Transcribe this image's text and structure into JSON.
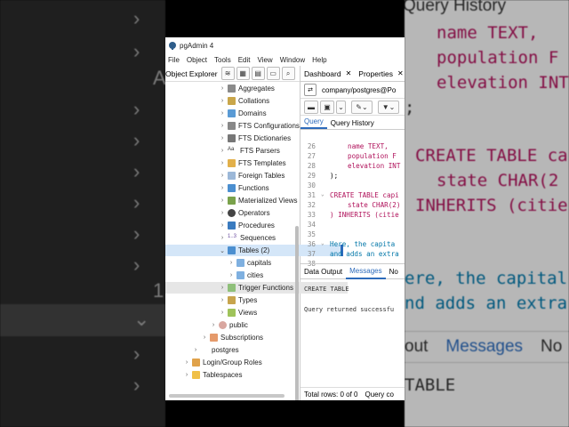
{
  "background_left": {
    "rows": [
      "",
      "",
      "A",
      "",
      "",
      "",
      "",
      "",
      "1.",
      "",
      ""
    ]
  },
  "background_right": {
    "title": "Query History",
    "lines": [
      "name TEXT,",
      "population F",
      "elevation INT",
      ";",
      "",
      "CREATE TABLE capi",
      "state CHAR(2",
      "INHERITS (citie",
      "",
      "ere, the capital",
      "nd adds an extra"
    ],
    "tabs": [
      "out",
      "Messages",
      "No"
    ],
    "bottom": "TABLE"
  },
  "window": {
    "title": "pgAdmin 4",
    "menu": [
      "File",
      "Object",
      "Tools",
      "Edit",
      "View",
      "Window",
      "Help"
    ]
  },
  "explorer": {
    "title": "Object Explorer",
    "nodes": [
      {
        "label": "Aggregates"
      },
      {
        "label": "Collations"
      },
      {
        "label": "Domains"
      },
      {
        "label": "FTS Configurations"
      },
      {
        "label": "FTS Dictionaries"
      },
      {
        "label": "FTS Parsers"
      },
      {
        "label": "FTS Templates"
      },
      {
        "label": "Foreign Tables"
      },
      {
        "label": "Functions"
      },
      {
        "label": "Materialized Views"
      },
      {
        "label": "Operators"
      },
      {
        "label": "Procedures"
      },
      {
        "label": "Sequences"
      },
      {
        "label": "Tables (2)"
      },
      {
        "label": "capitals"
      },
      {
        "label": "cities"
      },
      {
        "label": "Trigger Functions"
      },
      {
        "label": "Types"
      },
      {
        "label": "Views"
      },
      {
        "label": "public"
      },
      {
        "label": "Subscriptions"
      },
      {
        "label": "postgres"
      },
      {
        "label": "Login/Group Roles"
      },
      {
        "label": "Tablespaces"
      }
    ]
  },
  "tabs": {
    "dashboard": "Dashboard",
    "properties": "Properties"
  },
  "connection": "company/postgres@Po",
  "query_tabs": [
    "Query",
    "Query History"
  ],
  "editor": {
    "lines": [
      {
        "n": "26",
        "code": "name TEXT,"
      },
      {
        "n": "27",
        "code": "population F"
      },
      {
        "n": "28",
        "code": "elevation INT"
      },
      {
        "n": "29",
        "code": ");"
      },
      {
        "n": "30",
        "code": ""
      },
      {
        "n": "31",
        "code": "CREATE TABLE capi"
      },
      {
        "n": "32",
        "code": "state CHAR(2)"
      },
      {
        "n": "33",
        "code": ") INHERITS (citie"
      },
      {
        "n": "34",
        "code": ""
      },
      {
        "n": "35",
        "code": ""
      },
      {
        "n": "36",
        "code": "Here, the capita"
      },
      {
        "n": "37",
        "code": "and adds an extra"
      },
      {
        "n": "38",
        "code": ""
      }
    ]
  },
  "result_tabs": [
    "Data Output",
    "Messages",
    "No"
  ],
  "messages": {
    "line1": "CREATE TABLE",
    "line2": "Query returned successfu"
  },
  "status": {
    "rows": "Total rows: 0 of 0",
    "query": "Query co"
  }
}
